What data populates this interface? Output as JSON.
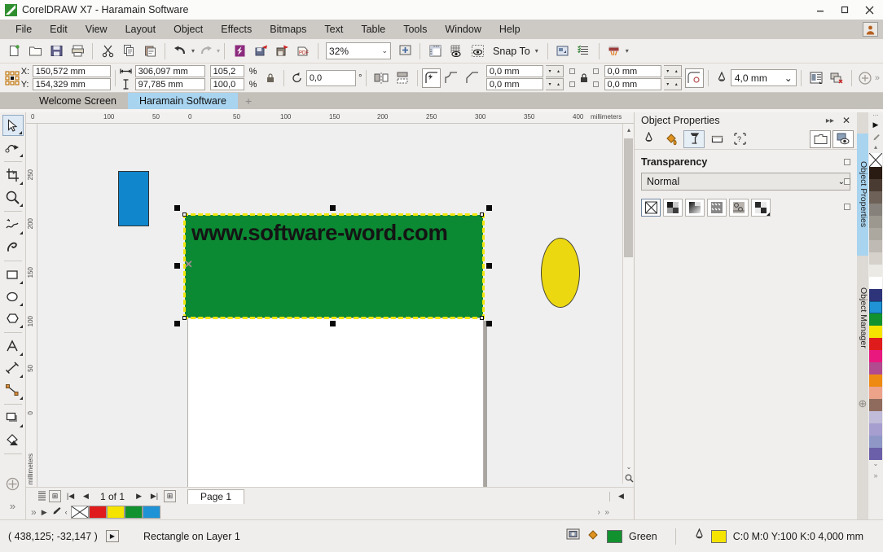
{
  "window": {
    "title": "CorelDRAW X7 - Haramain Software",
    "minimize": "–",
    "maximize": "□",
    "close": "✕"
  },
  "menubar": {
    "items": [
      {
        "label": "File",
        "accel": "F"
      },
      {
        "label": "Edit",
        "accel": "E"
      },
      {
        "label": "View",
        "accel": "V"
      },
      {
        "label": "Layout",
        "accel": "L"
      },
      {
        "label": "Object",
        "accel": "O"
      },
      {
        "label": "Effects",
        "accel": "c"
      },
      {
        "label": "Bitmaps",
        "accel": "B"
      },
      {
        "label": "Text",
        "accel": "x"
      },
      {
        "label": "Table",
        "accel": "T"
      },
      {
        "label": "Tools",
        "accel": "o"
      },
      {
        "label": "Window",
        "accel": "W"
      },
      {
        "label": "Help",
        "accel": "H"
      }
    ]
  },
  "toolbar": {
    "new_label": "New",
    "open_label": "Open",
    "save_label": "Save",
    "print_label": "Print",
    "cut_label": "Cut",
    "copy_label": "Copy",
    "paste_label": "Paste",
    "undo_label": "Undo",
    "redo_label": "Redo",
    "import_label": "Import",
    "export_label": "Export",
    "publish_pdf_label": "Publish to PDF",
    "zoom_level": "32%",
    "zoom_caret": "⌄",
    "fullscreen_label": "Full-screen preview",
    "snap_to_label": "Snap To",
    "snap_caret": "▾",
    "options_label": "Options",
    "workspace_caret": "▾"
  },
  "propertybar": {
    "x_label": "X:",
    "y_label": "Y:",
    "x_value": "150,572 mm",
    "y_value": "154,329 mm",
    "width_value": "306,097 mm",
    "height_value": "97,785 mm",
    "scale_h": "105,2",
    "scale_v": "100,0",
    "percent": "%",
    "lock_ratio": "lock-icon",
    "rotation_value": "0,0",
    "degree": "°",
    "outline_width": "4,0 mm",
    "corner_tl": "0,0 mm",
    "corner_bl": "0,0 mm",
    "corner_tr": "0,0 mm",
    "corner_br": "0,0 mm",
    "overflow_caret": "»"
  },
  "tabs": {
    "items": [
      {
        "label": "Welcome Screen",
        "active": false
      },
      {
        "label": "Haramain Software",
        "active": true
      }
    ],
    "add_label": "+"
  },
  "toolbox": {
    "tools": [
      {
        "name": "pick-tool",
        "active": true
      },
      {
        "name": "shape-tool",
        "active": false
      },
      {
        "name": "crop-tool",
        "active": false
      },
      {
        "name": "zoom-tool",
        "active": false
      },
      {
        "name": "freehand-tool",
        "active": false
      },
      {
        "name": "artistic-media-tool",
        "active": false
      },
      {
        "name": "rectangle-tool",
        "active": false
      },
      {
        "name": "ellipse-tool",
        "active": false
      },
      {
        "name": "polygon-tool",
        "active": false
      },
      {
        "name": "text-tool",
        "active": false
      },
      {
        "name": "dimension-tool",
        "active": false
      },
      {
        "name": "connector-tool",
        "active": false
      },
      {
        "name": "shadow-tool",
        "active": false
      },
      {
        "name": "fill-tool",
        "active": false
      },
      {
        "name": "quick-customize-tool",
        "active": false
      }
    ],
    "expand_label": "»"
  },
  "rulers": {
    "h_ticks": [
      "0",
      "100",
      "50",
      "0",
      "50",
      "100",
      "150",
      "200",
      "250",
      "300",
      "350",
      "400"
    ],
    "h_unit": "millimeters",
    "v_ticks": [
      "250",
      "200",
      "150",
      "100",
      "50",
      "0"
    ],
    "v_unit": "millimeters"
  },
  "canvas": {
    "objects": [
      {
        "name": "blue-rectangle",
        "fill": "#1086cd"
      },
      {
        "name": "green-rectangle",
        "fill": "#0b8a33",
        "selected": true
      },
      {
        "name": "yellow-ellipse",
        "fill": "#ecd810"
      }
    ],
    "text_object": "www.software-word.com",
    "selection_outline_color": "#f2e70c",
    "center_marker": "✕"
  },
  "pagenav": {
    "add_page_start": "⊞",
    "first": "|◀",
    "prev": "◀",
    "counter": "1 of 1",
    "next": "▶",
    "last": "▶|",
    "add_page_end": "⊞",
    "page_tab": "Page 1",
    "scroll_left": "◀",
    "scroll_right": "▶",
    "zoom_btn": "zoom-icon"
  },
  "bottom_palette": {
    "eyedropper": "eyedropper-icon",
    "none_swatch": "✕",
    "swatches": [
      "#e01b1b",
      "#f5e400",
      "#12912f",
      "#1f93d6"
    ],
    "overflow": "»"
  },
  "docker": {
    "title": "Object Properties",
    "collapse": "▸▸",
    "close": "✕",
    "tabs": [
      {
        "name": "outline-tab",
        "selected": false
      },
      {
        "name": "fill-tab",
        "selected": false
      },
      {
        "name": "transparency-tab",
        "selected": true
      },
      {
        "name": "rectangle-tab",
        "selected": false
      },
      {
        "name": "summary-tab",
        "selected": false
      }
    ],
    "right_tabs": [
      {
        "name": "folder-icon"
      },
      {
        "name": "preview-icon",
        "selected": true
      }
    ],
    "section_title": "Transparency",
    "merge_mode_value": "Normal",
    "merge_caret": "⌄",
    "transparency_types": [
      {
        "name": "no-transparency",
        "selected": true
      },
      {
        "name": "uniform-transparency",
        "selected": false
      },
      {
        "name": "fountain-transparency",
        "selected": false
      },
      {
        "name": "vector-pattern-transparency",
        "selected": false
      },
      {
        "name": "bitmap-pattern-transparency",
        "selected": false
      },
      {
        "name": "two-color-pattern-transparency",
        "selected": false
      }
    ]
  },
  "side_tabs": [
    {
      "label": "Object Properties",
      "active": true
    },
    {
      "label": "Object Manager",
      "active": false
    }
  ],
  "color_palette": {
    "scroll_up": "▴",
    "scroll_down": "⌄",
    "expand": "»",
    "none_swatch": "✕",
    "pointer": "▶",
    "eyedropper": "eyedropper-icon",
    "colors": [
      "#2a1b12",
      "#4a3b32",
      "#6d6158",
      "#86817a",
      "#9c978f",
      "#aca79f",
      "#bfbab3",
      "#d6d2cb",
      "#eceae5",
      "#ffffff",
      "#2d3479",
      "#1f93d6",
      "#12912f",
      "#f5e400",
      "#e01b1b",
      "#e8187f",
      "#b14a8f",
      "#ee8a12",
      "#eda28a",
      "#8e6b5c",
      "#c0bbd8",
      "#a79ed0",
      "#8f97c7",
      "#6a5fa8"
    ]
  },
  "statusbar": {
    "coordinates": "( 438,125; -32,147 )",
    "play_icon": "▶",
    "object_info": "Rectangle on Layer 1",
    "fill_label": "Green",
    "fill_color": "#12912f",
    "outline_label": "C:0 M:0 Y:100 K:0  4,000 mm",
    "outline_color": "#f5e400"
  }
}
